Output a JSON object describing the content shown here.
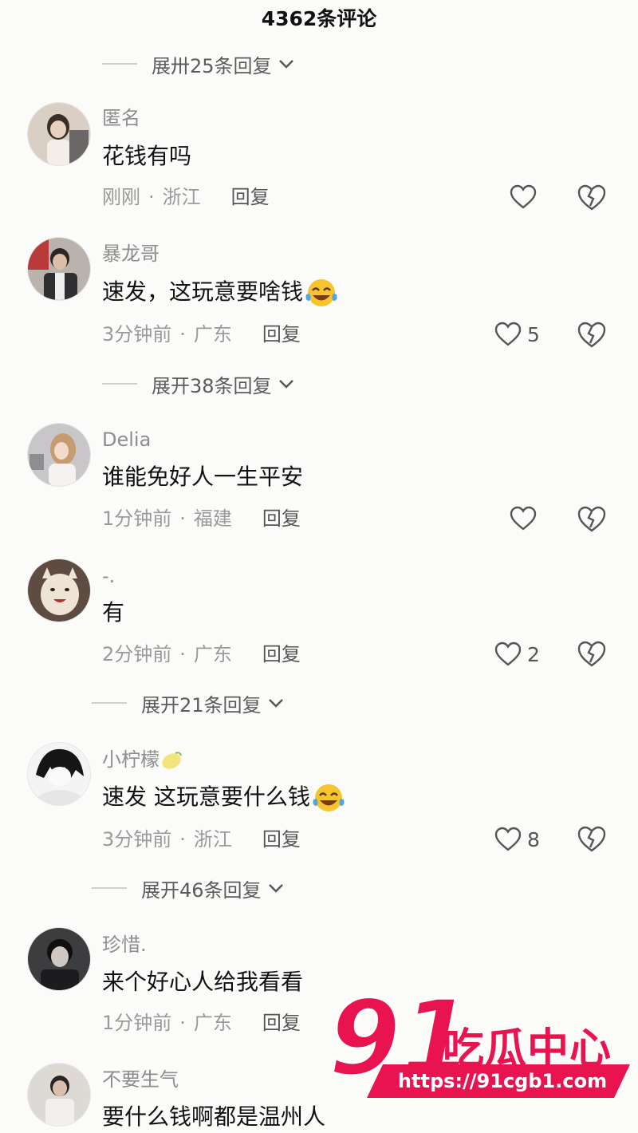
{
  "header": {
    "title": "4362条评论"
  },
  "top_expand": {
    "label": "展卅25条回复"
  },
  "comments": [
    {
      "username": "匿名",
      "text": "花钱有吗",
      "time": "刚刚",
      "region": "浙江",
      "reply_label": "回复",
      "likes": ""
    },
    {
      "username": "暴龙哥",
      "text": "速发，这玩意要啥钱",
      "time": "3分钟前",
      "region": "广东",
      "reply_label": "回复",
      "likes": "5",
      "expand_label": "展开38条回复"
    },
    {
      "username": "Delia",
      "text": "谁能免好人一生平安",
      "time": "1分钟前",
      "region": "福建",
      "reply_label": "回复",
      "likes": ""
    },
    {
      "username": "-.",
      "text": "有",
      "time": "2分钟前",
      "region": "广东",
      "reply_label": "回复",
      "likes": "2",
      "expand_label": "展开21条回复"
    },
    {
      "username": "小柠檬",
      "text": "速发 这玩意要什么钱",
      "time": "3分钟前",
      "region": "浙江",
      "reply_label": "回复",
      "likes": "8",
      "expand_label": "展开46条回复"
    },
    {
      "username": "珍惜.",
      "text": "来个好心人给我看看",
      "time": "1分钟前",
      "region": "广东",
      "reply_label": "回复",
      "likes": ""
    },
    {
      "username": "不要生气",
      "text": "要什么钱啊都是温州人",
      "time": "",
      "region": "",
      "reply_label": "",
      "likes": ""
    }
  ],
  "meta_separator": "·",
  "watermark": {
    "number": "91",
    "name": "吃瓜中心",
    "url": "https://91cgb1.com"
  },
  "colors": {
    "background": "#fbfbf9",
    "watermark": "#e8134f",
    "muted": "#9a9a9a"
  },
  "icons": {
    "like": "heart-outline-icon",
    "dislike": "broken-heart-icon",
    "expand": "chevron-down-icon"
  }
}
